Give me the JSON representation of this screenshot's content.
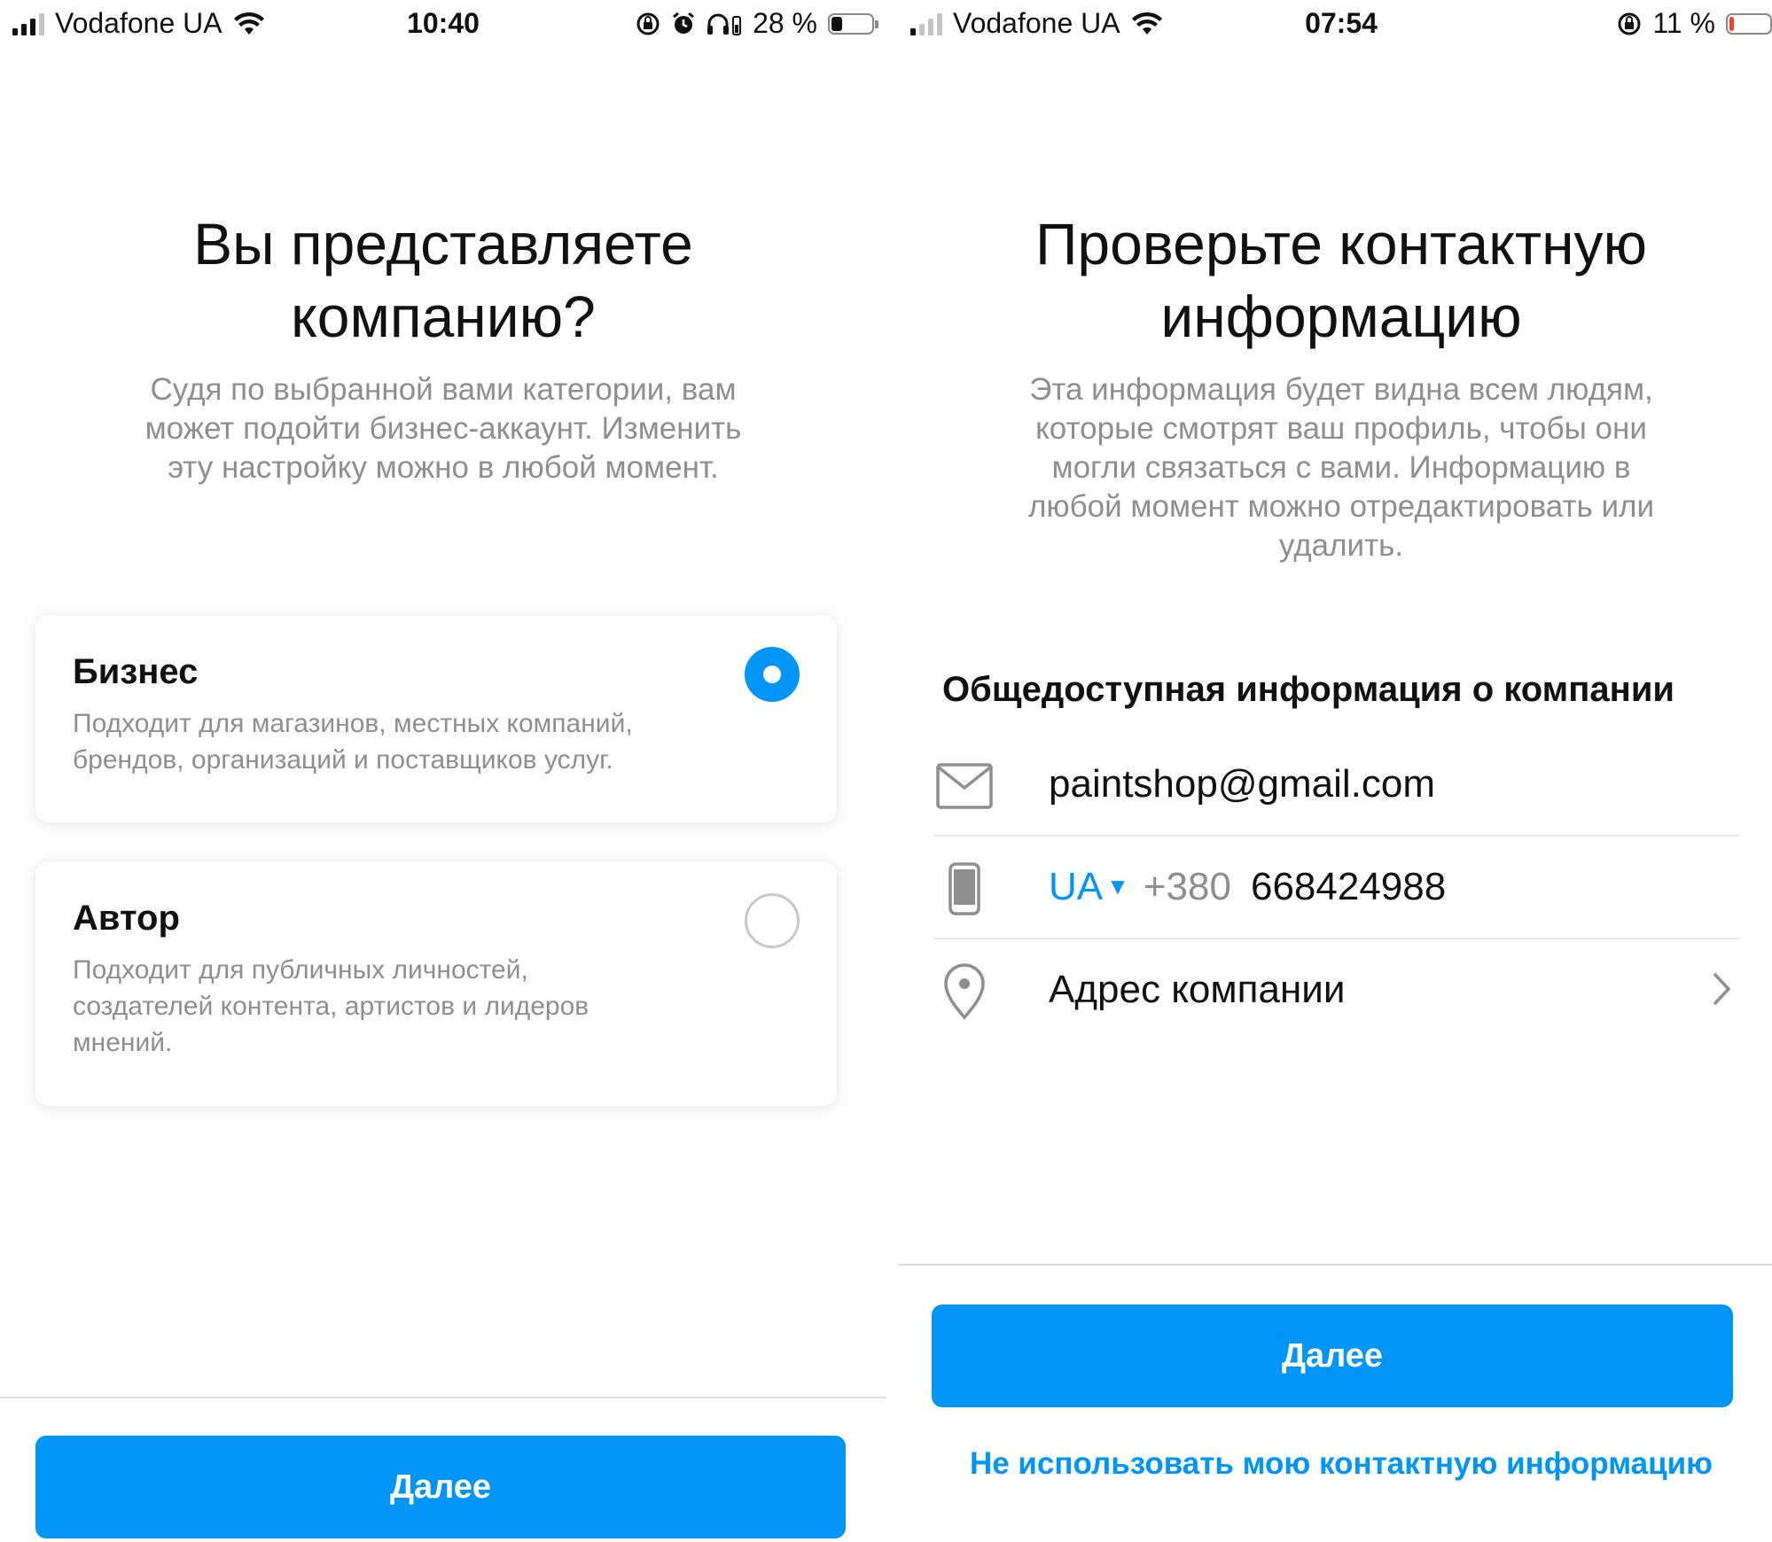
{
  "left_screen": {
    "status": {
      "carrier": "Vodafone UA",
      "time": "10:40",
      "battery_percent": "28 %",
      "battery_level": 0.28,
      "icons": [
        "signal-icon",
        "wifi-icon",
        "orientation-lock-icon",
        "alarm-icon",
        "headphones-icon",
        "battery-icon"
      ]
    },
    "title_line1": "Вы представляете",
    "title_line2": "компанию?",
    "subtitle_lines": [
      "Судя по выбранной вами категории, вам",
      "может подойти бизнес-аккаунт. Изменить",
      "эту настройку можно в любой момент."
    ],
    "options": [
      {
        "title": "Бизнес",
        "desc_lines": [
          "Подходит для магазинов, местных компаний,",
          "брендов, организаций и поставщиков услуг."
        ],
        "selected": true
      },
      {
        "title": "Автор",
        "desc_lines": [
          "Подходит для публичных личностей,",
          "создателей контента, артистов и лидеров",
          "мнений."
        ],
        "selected": false
      }
    ],
    "next_button": "Далее"
  },
  "right_screen": {
    "status": {
      "carrier": "Vodafone UA",
      "time": "07:54",
      "battery_percent": "11 %",
      "battery_level": 0.11,
      "icons": [
        "signal-icon",
        "wifi-icon",
        "orientation-lock-icon",
        "battery-icon"
      ]
    },
    "title_line1": "Проверьте контактную",
    "title_line2": "информацию",
    "subtitle_lines": [
      "Эта информация будет видна всем людям,",
      "которые смотрят ваш профиль, чтобы они",
      "могли связаться с вами. Информацию в",
      "любой момент можно отредактировать или",
      "удалить."
    ],
    "section_title": "Общедоступная информация о компании",
    "email": "paintshop@gmail.com",
    "phone_country": "UA",
    "phone_prefix": "+380",
    "phone_number": "668424988",
    "address_placeholder": "Адрес компании",
    "next_button": "Далее",
    "skip_link": "Не использовать мою контактную информацию"
  },
  "colors": {
    "accent": "#0095f6",
    "text_primary": "#111111",
    "text_secondary": "#8e8e8e",
    "battery_low": "#ff3b30"
  }
}
